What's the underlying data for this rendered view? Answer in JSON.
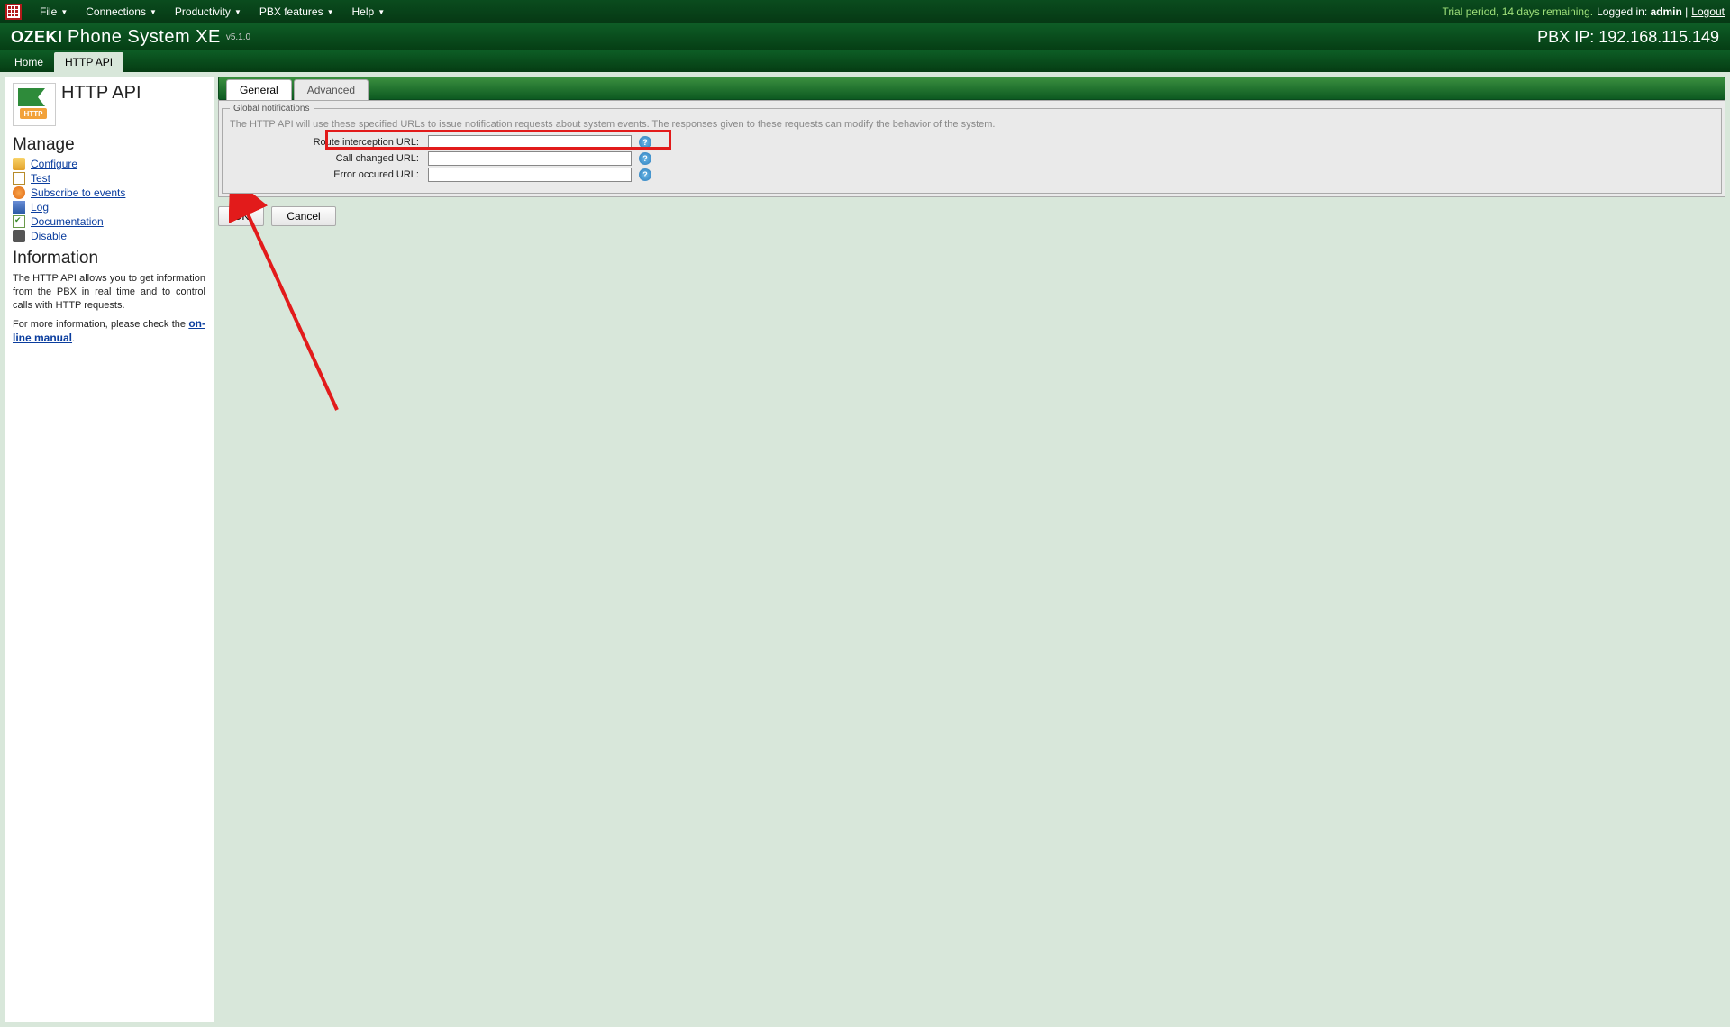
{
  "menubar": {
    "items": [
      "File",
      "Connections",
      "Productivity",
      "PBX features",
      "Help"
    ],
    "trial": "Trial period, 14 days remaining.",
    "logged_prefix": "Logged in: ",
    "user": "admin",
    "logout": "Logout"
  },
  "titlebar": {
    "brand1": "OZEKI",
    "brand2": "Phone System XE",
    "version": "v5.1.0",
    "ip_label": "PBX IP: ",
    "ip": "192.168.115.149"
  },
  "maintabs": {
    "home": "Home",
    "httpapi": "HTTP API"
  },
  "sidebar": {
    "title": "HTTP API",
    "manage_hdr": "Manage",
    "links": {
      "configure": "Configure",
      "test": "Test",
      "subscribe": "Subscribe to events",
      "log": "Log",
      "documentation": "Documentation",
      "disable": "Disable"
    },
    "info_hdr": "Information",
    "info_p1": "The HTTP API allows you to get information from the PBX in real time and to control calls with HTTP requests.",
    "info_p2a": "For more information, please check the ",
    "info_p2_link": "on-line manual",
    "info_p2b": "."
  },
  "content": {
    "tabs": {
      "general": "General",
      "advanced": "Advanced"
    },
    "fieldset_legend": "Global notifications",
    "description": "The HTTP API will use these specified URLs to issue notification requests about system events. The responses given to these requests can modify the behavior of the system.",
    "fields": {
      "route": {
        "label": "Route interception URL:",
        "value": ""
      },
      "call": {
        "label": "Call changed URL:",
        "value": ""
      },
      "error": {
        "label": "Error occured URL:",
        "value": ""
      }
    },
    "buttons": {
      "ok": "OK",
      "cancel": "Cancel"
    }
  }
}
